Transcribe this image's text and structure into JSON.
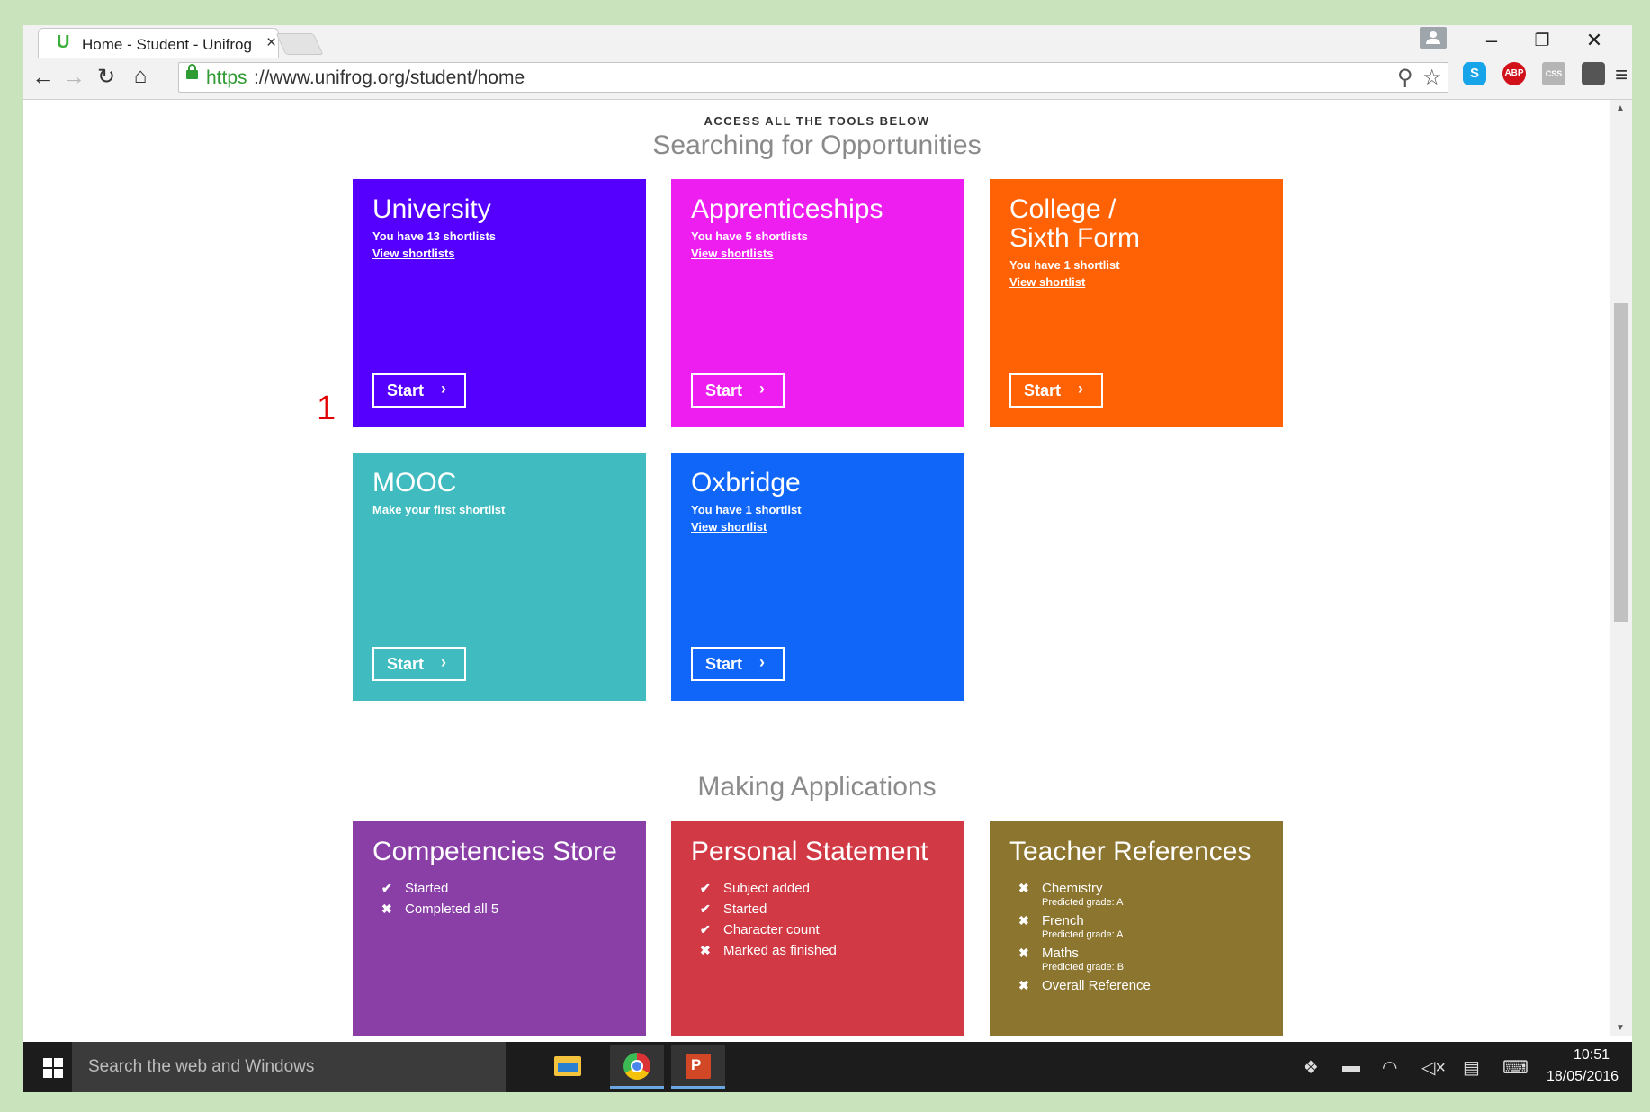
{
  "browser": {
    "tab_title": "Home - Student - Unifrog",
    "tab_favicon": "U",
    "tab_close": "×",
    "url_scheme": "https",
    "url_rest": "://www.unifrog.org/student/home"
  },
  "page": {
    "kicker": "ACCESS ALL THE TOOLS BELOW",
    "section1_title": "Searching for Opportunities",
    "section2_title": "Making Applications",
    "start_label": "Start",
    "annotation": "1"
  },
  "tiles": {
    "university": {
      "title": "University",
      "sub": "You have 13 shortlists",
      "link": "View shortlists",
      "color": "#5500ff"
    },
    "apprenticeships": {
      "title": "Apprenticeships",
      "sub": "You have 5 shortlists",
      "link": "View shortlists",
      "color": "#ee1df0"
    },
    "college": {
      "title": "College /\nSixth Form",
      "sub": "You have 1 shortlist",
      "link": "View shortlist",
      "color": "#ff6205"
    },
    "mooc": {
      "title": "MOOC",
      "sub": "Make your first shortlist",
      "color": "#40bcc0"
    },
    "oxbridge": {
      "title": "Oxbridge",
      "sub": "You have 1 shortlist",
      "link": "View shortlist",
      "color": "#0f66f8"
    },
    "competencies": {
      "title": "Competencies Store",
      "color": "#8a3fa7",
      "items": [
        {
          "label": "Started",
          "status": "check"
        },
        {
          "label": "Completed all 5",
          "status": "cross"
        }
      ]
    },
    "personal": {
      "title": "Personal Statement",
      "color": "#d13a45",
      "items": [
        {
          "label": "Subject added",
          "status": "check"
        },
        {
          "label": "Started",
          "status": "check"
        },
        {
          "label": "Character count",
          "status": "check"
        },
        {
          "label": "Marked as finished",
          "status": "cross"
        }
      ]
    },
    "teacher": {
      "title": "Teacher References",
      "color": "#8c752f",
      "items": [
        {
          "label": "Chemistry",
          "detail": "Predicted grade: A",
          "status": "cross"
        },
        {
          "label": "French",
          "detail": "Predicted grade: A",
          "status": "cross"
        },
        {
          "label": "Maths",
          "detail": "Predicted grade: B",
          "status": "cross"
        },
        {
          "label": "Overall Reference",
          "status": "cross"
        }
      ]
    }
  },
  "taskbar": {
    "search_placeholder": "Search the web and Windows",
    "time": "10:51",
    "date": "18/05/2016"
  },
  "extensions": {
    "skype": "S",
    "adblock": "ABP",
    "css": "CSS"
  },
  "icons": {
    "back": "arrow-left-icon",
    "forward": "arrow-right-icon",
    "reload": "reload-icon",
    "home": "home-icon",
    "zoom": "magnifier-icon",
    "star": "star-icon",
    "menu": "hamburger-menu-icon"
  }
}
